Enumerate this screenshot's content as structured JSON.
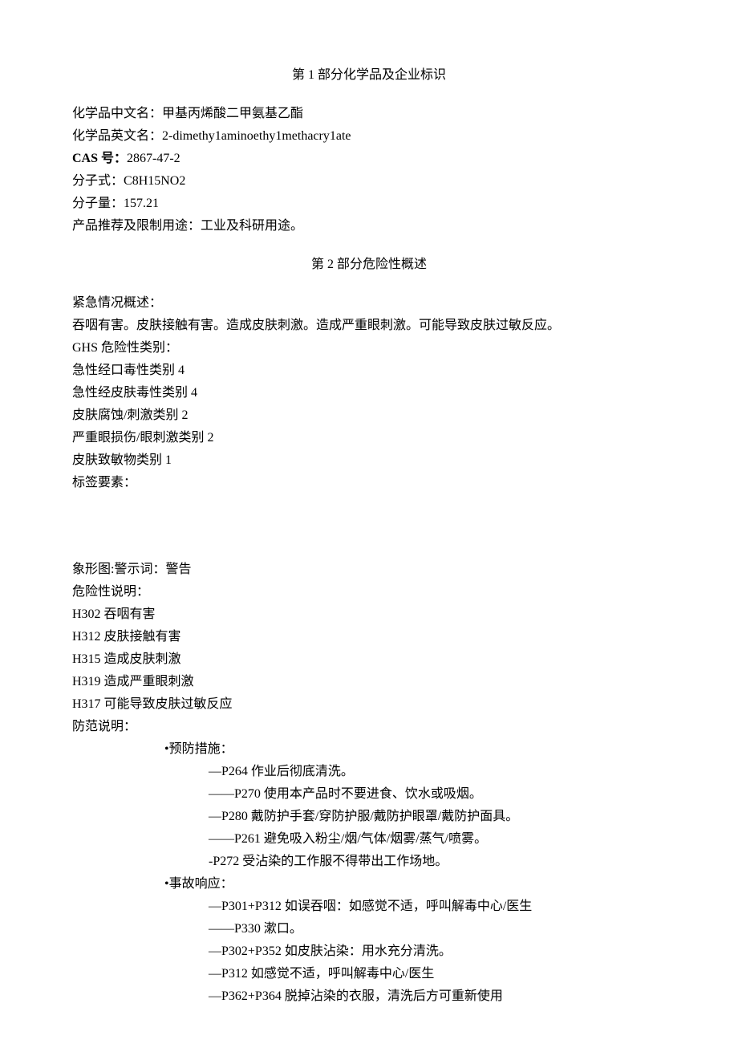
{
  "section1": {
    "title": "第 1 部分化学品及企业标识",
    "fields": {
      "name_cn_label": "化学品中文名：",
      "name_cn_value": "甲基丙烯酸二甲氨基乙酯",
      "name_en_label": "化学品英文名：",
      "name_en_value": "2-dimethy1aminoethy1methacry1ate",
      "cas_label": "CAS 号：",
      "cas_value": "2867-47-2",
      "formula_label": "分子式：",
      "formula_value": "C8H15NO2",
      "mw_label": "分子量：",
      "mw_value": "157.21",
      "use_label": "产品推荐及限制用途：",
      "use_value": "工业及科研用途。"
    }
  },
  "section2": {
    "title": "第 2 部分危险性概述",
    "emergency_label": "紧急情况概述：",
    "emergency_text": "吞咽有害。皮肤接触有害。造成皮肤刺激。造成严重眼刺激。可能导致皮肤过敏反应。",
    "ghs_label": "GHS 危险性类别：",
    "ghs_items": [
      "急性经口毒性类别 4",
      "急性经皮肤毒性类别 4",
      "皮肤腐蚀/刺激类别 2",
      "严重眼损伤/眼刺激类别 2",
      "皮肤致敏物类别 1"
    ],
    "label_elements": "标签要素：",
    "pictogram_line": "象形图:警示词：警告",
    "hazard_label": "危险性说明：",
    "hazard_items": [
      "H302 吞咽有害",
      "H312 皮肤接触有害",
      "H315 造成皮肤刺激",
      "H319 造成严重眼刺激",
      "H317 可能导致皮肤过敏反应"
    ],
    "precaution_label": "防范说明：",
    "prevention_label": "•预防措施：",
    "prevention_items": [
      "—P264 作业后彻底清洗。",
      "——P270 使用本产品时不要进食、饮水或吸烟。",
      "—P280 戴防护手套/穿防护服/戴防护眼罩/戴防护面具。",
      "——P261 避免吸入粉尘/烟/气体/烟雾/蒸气/喷雾。",
      "-P272 受沾染的工作服不得带出工作场地。"
    ],
    "response_label": "•事故响应：",
    "response_items": [
      "—P301+P312 如误吞咽：如感觉不适，呼叫解毒中心/医生",
      "——P330 漱口。",
      "—P302+P352 如皮肤沾染：用水充分清洗。",
      "—P312 如感觉不适，呼叫解毒中心/医生",
      "—P362+P364 脱掉沾染的衣服，清洗后方可重新使用"
    ]
  }
}
